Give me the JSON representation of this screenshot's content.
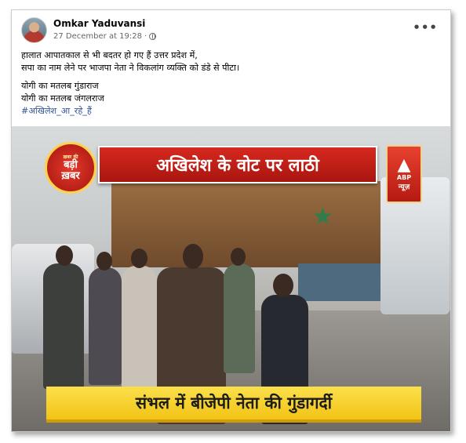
{
  "post": {
    "author": "Omkar Yaduvansi",
    "timestamp": "27 December at 19:28",
    "separator": "·",
    "more_icon": "more-horizontal-icon",
    "privacy_icon": "globe-icon",
    "more_glyph": "•••"
  },
  "body": {
    "lines": [
      "हालात आपातकाल से भी बदतर हो गए हैं उत्तर प्रदेश में,",
      " सपा का नाम लेने पर भाजपा नेता ने विकलांग व्यक्ति को डंडे से पीटा।",
      "योगी का मतलब गुंडाराज",
      "योगी का मतलब जंगलराज"
    ],
    "hashtag": "#अखिलेश_आ_रहे_हैं"
  },
  "video": {
    "headline": "अखिलेश के वोट पर लाठी",
    "badge_top": "ख़बर की",
    "badge_line1": "बड़ी",
    "badge_line2": "ख़बर",
    "channel_logo_mark": "▲",
    "channel_logo_text": "ABP",
    "channel_logo_sub": "न्यूज़",
    "caption": "संभल में बीजेपी नेता की गुंडागर्दी"
  },
  "colors": {
    "link": "#385898",
    "banner_red": "#c41e16",
    "caption_yellow": "#f6d12e"
  }
}
